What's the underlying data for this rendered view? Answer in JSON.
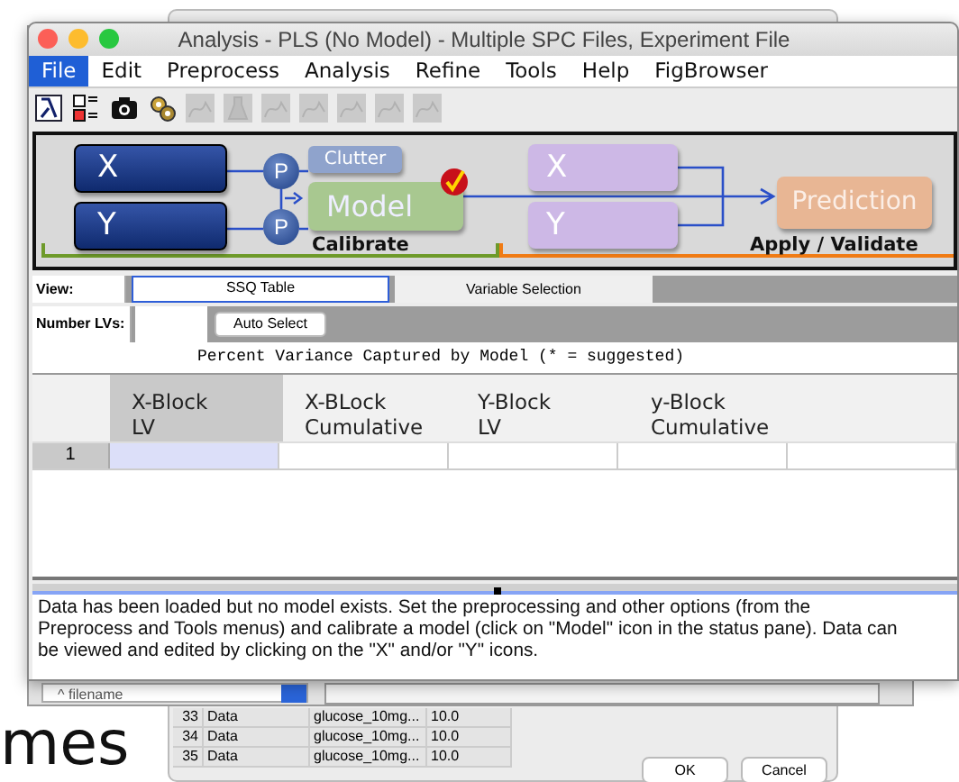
{
  "background_text": "mes",
  "back_dialog": {
    "rows": [
      {
        "index": "33",
        "type": "Data",
        "file": "glucose_10mg...",
        "value": "10.0"
      },
      {
        "index": "34",
        "type": "Data",
        "file": "glucose_10mg...",
        "value": "10.0"
      },
      {
        "index": "35",
        "type": "Data",
        "file": "glucose_10mg...",
        "value": "10.0"
      }
    ],
    "buttons": [
      "OK",
      "Cancel"
    ]
  },
  "middle_window": {
    "sort_field": "^ filename"
  },
  "window": {
    "title": "Analysis - PLS (No Model) - Multiple SPC Files, Experiment File"
  },
  "menu": [
    {
      "label": "File",
      "selected": true
    },
    {
      "label": "Edit",
      "selected": false
    },
    {
      "label": "Preprocess",
      "selected": false
    },
    {
      "label": "Analysis",
      "selected": false
    },
    {
      "label": "Refine",
      "selected": false
    },
    {
      "label": "Tools",
      "selected": false
    },
    {
      "label": "Help",
      "selected": false
    },
    {
      "label": "FigBrowser",
      "selected": false
    }
  ],
  "toolbar": [
    {
      "kind": "lambda",
      "disabled": false
    },
    {
      "kind": "ab",
      "disabled": false
    },
    {
      "kind": "camera",
      "disabled": false
    },
    {
      "kind": "gears",
      "disabled": false
    },
    {
      "kind": "plot",
      "disabled": true
    },
    {
      "kind": "flask",
      "disabled": true
    },
    {
      "kind": "plot",
      "disabled": true
    },
    {
      "kind": "plot",
      "disabled": true
    },
    {
      "kind": "plot",
      "disabled": true
    },
    {
      "kind": "plot",
      "disabled": true
    },
    {
      "kind": "plot",
      "disabled": true
    }
  ],
  "status_pane": {
    "x_block": "X",
    "y_block": "Y",
    "preprocess": [
      "P",
      "P"
    ],
    "clutter": "Clutter",
    "model": "Model",
    "model_checked": true,
    "calibrate": "Calibrate",
    "apply_x": "X",
    "apply_y": "Y",
    "prediction": "Prediction",
    "apply": "Apply / Validate"
  },
  "view": {
    "label": "View:",
    "tabs": [
      {
        "label": "SSQ Table",
        "selected": true
      },
      {
        "label": "Variable Selection",
        "selected": false
      }
    ]
  },
  "lvs": {
    "label": "Number LVs:",
    "button": "Auto Select"
  },
  "table": {
    "caption": "Percent Variance Captured by Model (* = suggested)",
    "columns": [
      {
        "label": "X-Block\nLV",
        "selected": true
      },
      {
        "label": "X-BLock\nCumulative",
        "selected": false
      },
      {
        "label": "Y-Block\nLV",
        "selected": false
      },
      {
        "label": "y-Block\nCumulative",
        "selected": false
      }
    ],
    "rows": [
      {
        "label": "1"
      }
    ]
  },
  "message": "Data has been loaded but no model exists. Set the preprocessing and other options (from the Preprocess and Tools menus) and calibrate a model (click on \"Model\" icon in the status pane). Data can be viewed and edited by clicking on the \"X\" and/or \"Y\" icons."
}
